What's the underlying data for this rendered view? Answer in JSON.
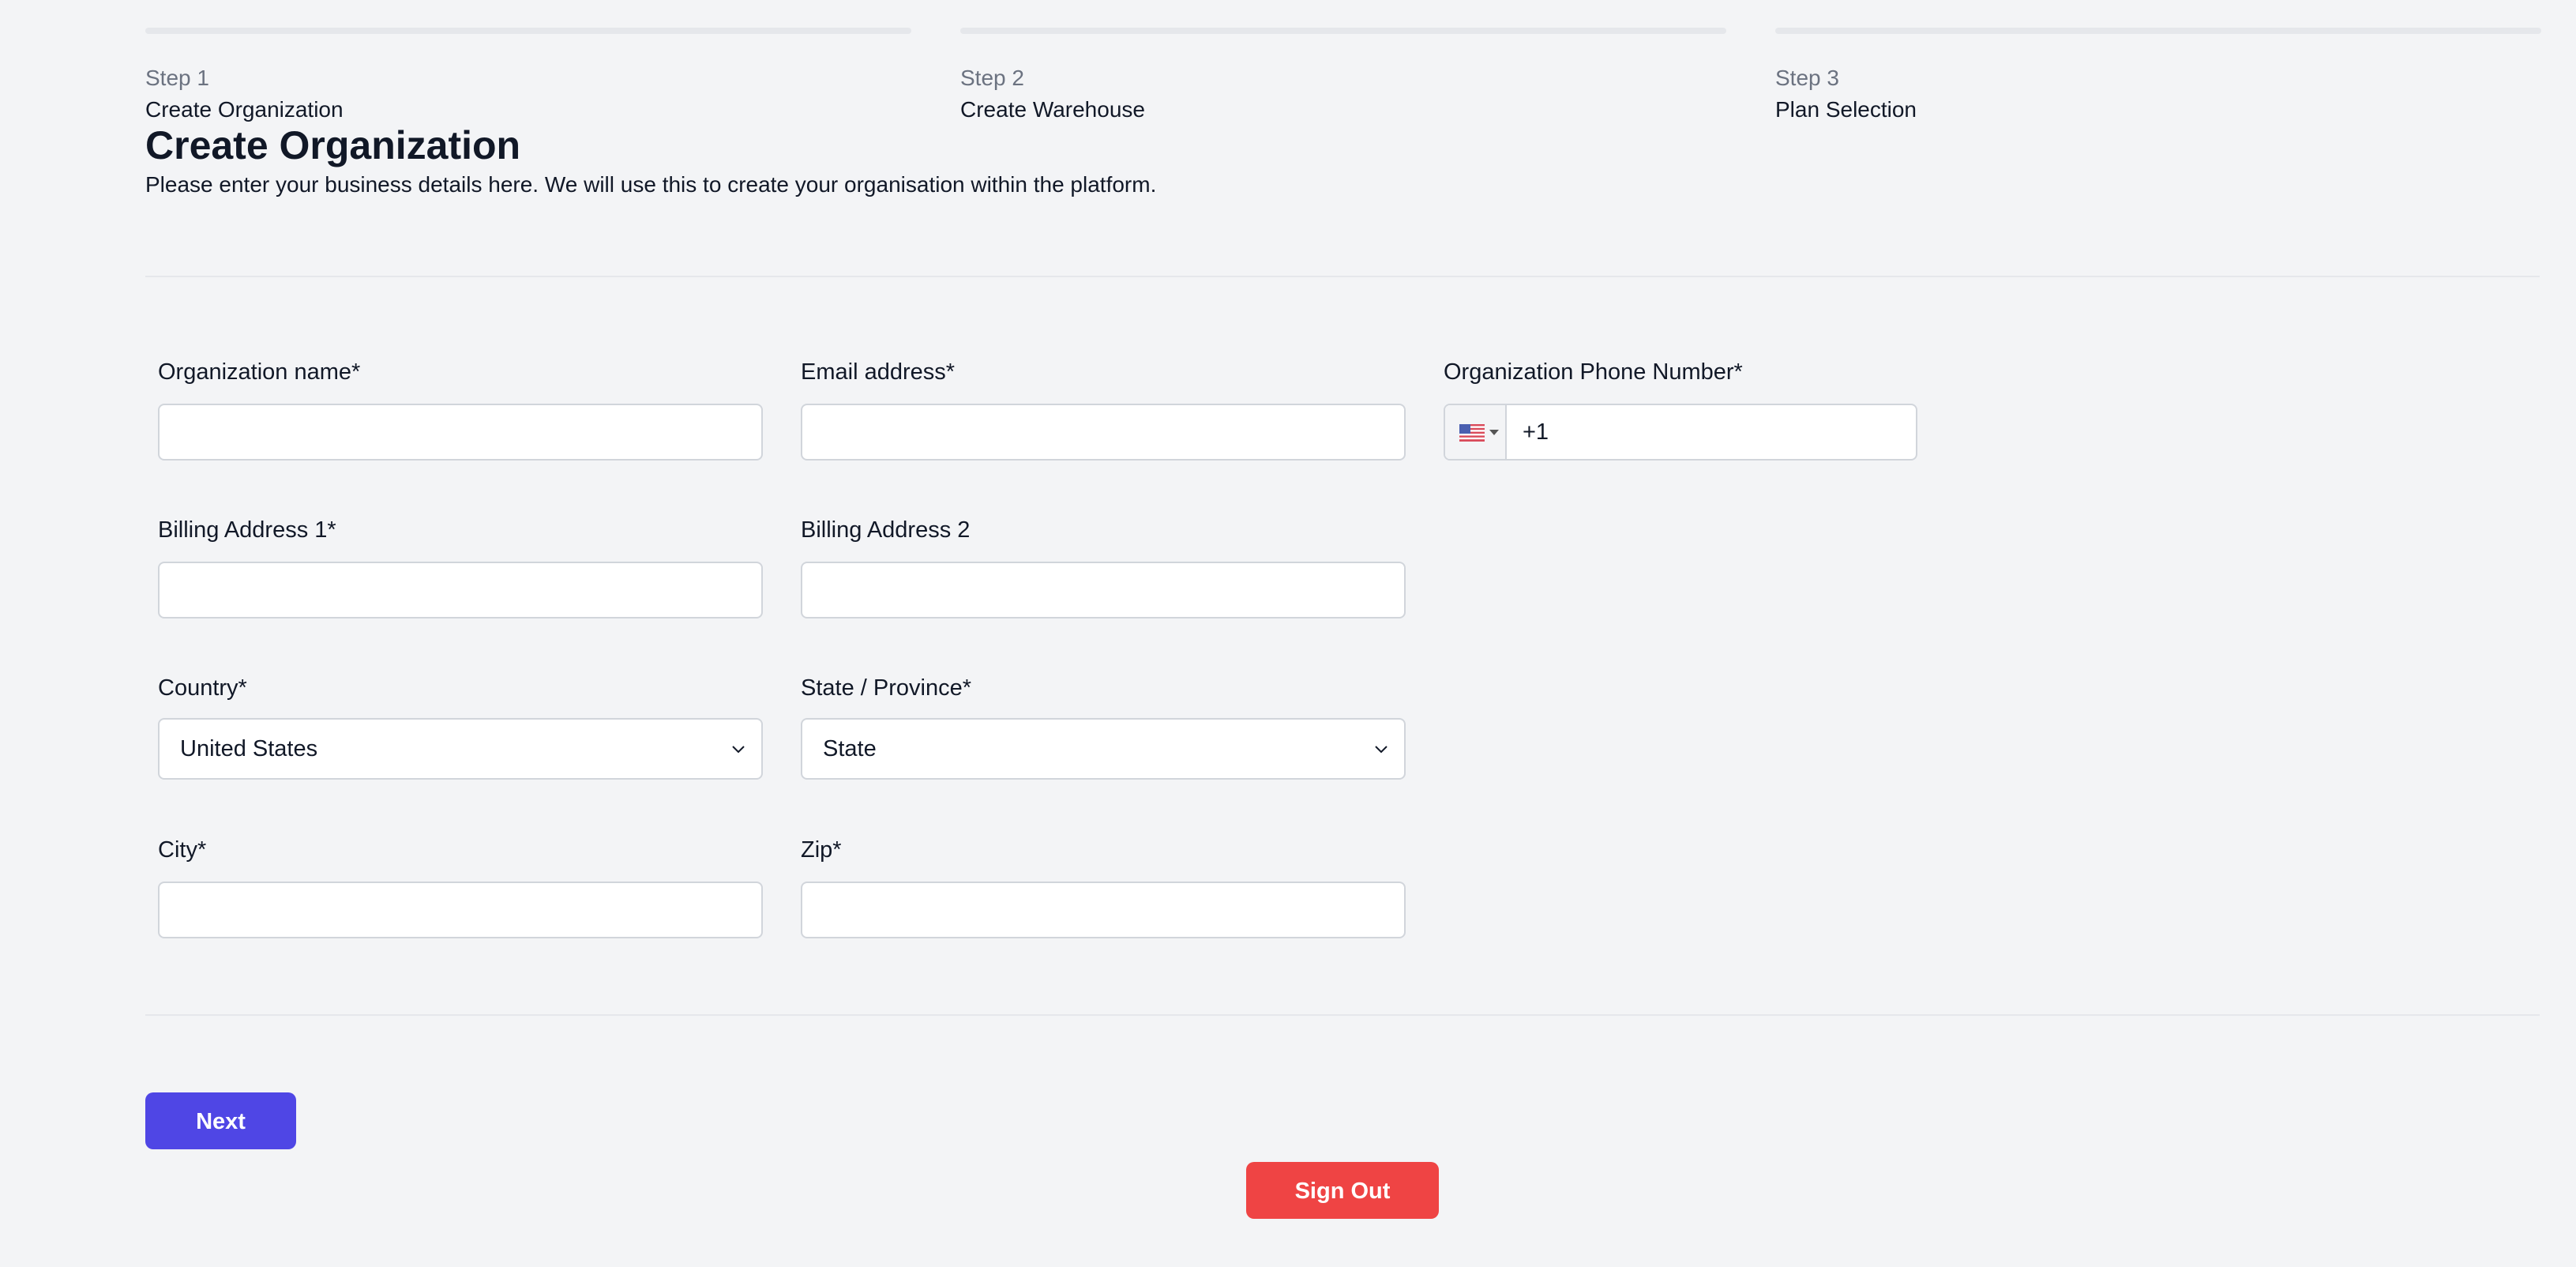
{
  "steps": [
    {
      "number": "Step 1",
      "name": "Create Organization"
    },
    {
      "number": "Step 2",
      "name": "Create Warehouse"
    },
    {
      "number": "Step 3",
      "name": "Plan Selection"
    }
  ],
  "header": {
    "title": "Create Organization",
    "description": "Please enter your business details here. We will use this to create your organisation within the platform."
  },
  "form": {
    "org_name": {
      "label": "Organization name*",
      "value": "",
      "placeholder": ""
    },
    "email": {
      "label": "Email address*",
      "value": "",
      "placeholder": ""
    },
    "phone": {
      "label": "Organization Phone Number*",
      "value": "+1",
      "flag_icon": "us-flag-icon"
    },
    "billing1": {
      "label": "Billing Address 1*",
      "value": "",
      "placeholder": ""
    },
    "billing2": {
      "label": "Billing Address 2",
      "value": "",
      "placeholder": ""
    },
    "country": {
      "label": "Country*",
      "selected": "United States"
    },
    "state": {
      "label": "State / Province*",
      "selected": "State"
    },
    "city": {
      "label": "City*",
      "value": "",
      "placeholder": ""
    },
    "zip": {
      "label": "Zip*",
      "value": "",
      "placeholder": ""
    }
  },
  "actions": {
    "next_label": "Next",
    "signout_label": "Sign Out"
  },
  "colors": {
    "primary": "#4f46e5",
    "danger": "#ef4444",
    "background": "#f3f4f6"
  }
}
